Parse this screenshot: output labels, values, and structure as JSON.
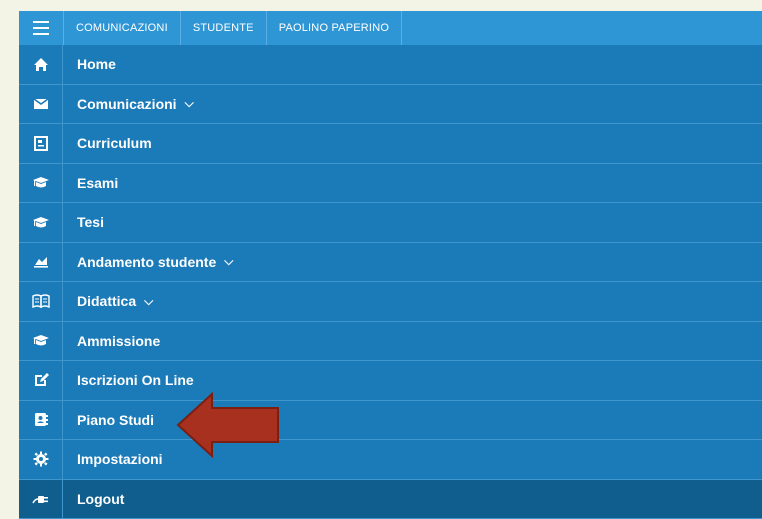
{
  "topbar": {
    "crumbs": [
      "COMUNICAZIONI",
      "STUDENTE",
      "PAOLINO PAPERINO"
    ]
  },
  "menu": {
    "items": [
      {
        "label": "Home",
        "icon": "home-icon"
      },
      {
        "label": "Comunicazioni",
        "icon": "envelope-icon",
        "expandable": true
      },
      {
        "label": "Curriculum",
        "icon": "document-icon"
      },
      {
        "label": "Esami",
        "icon": "graduation-cap-icon"
      },
      {
        "label": "Tesi",
        "icon": "graduation-cap-icon"
      },
      {
        "label": "Andamento studente",
        "icon": "area-chart-icon",
        "expandable": true
      },
      {
        "label": "Didattica",
        "icon": "book-icon",
        "expandable": true
      },
      {
        "label": "Ammissione",
        "icon": "graduation-cap-icon"
      },
      {
        "label": "Iscrizioni On Line",
        "icon": "edit-icon"
      },
      {
        "label": "Piano Studi",
        "icon": "contact-book-icon"
      },
      {
        "label": "Impostazioni",
        "icon": "gear-icon"
      },
      {
        "label": "Logout",
        "icon": "plug-icon"
      }
    ]
  },
  "colors": {
    "topbar": "#2f96d6",
    "menu": "#1b7ab8",
    "logout": "#0f5e8e",
    "arrow": "#a8301e",
    "page": "#f3f3e6"
  }
}
